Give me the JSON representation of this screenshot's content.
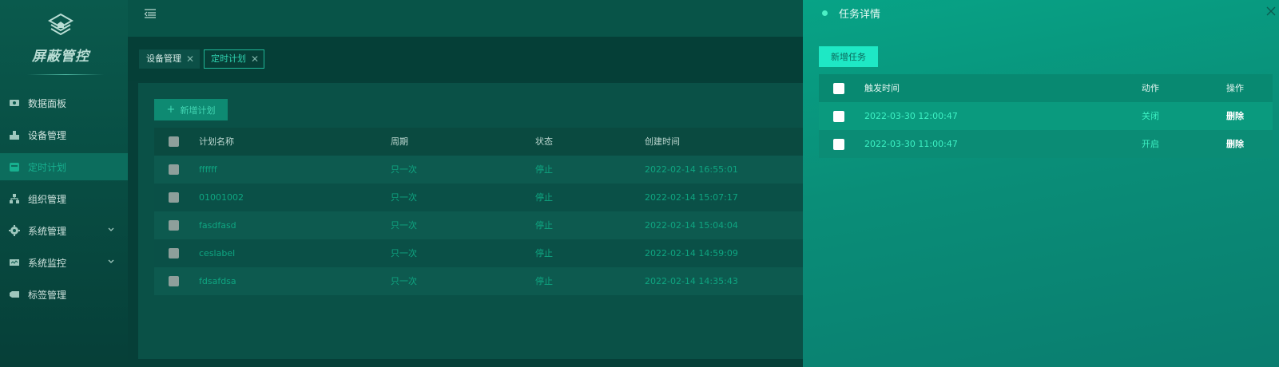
{
  "app": {
    "title": "屏蔽管控"
  },
  "sidebar": {
    "items": [
      {
        "label": "数据面板",
        "icon": "dashboard-icon"
      },
      {
        "label": "设备管理",
        "icon": "device-icon"
      },
      {
        "label": "定时计划",
        "icon": "schedule-icon",
        "active": true
      },
      {
        "label": "组织管理",
        "icon": "org-icon"
      },
      {
        "label": "系统管理",
        "icon": "gear-icon",
        "expandable": true
      },
      {
        "label": "系统监控",
        "icon": "monitor-icon",
        "expandable": true
      },
      {
        "label": "标签管理",
        "icon": "tag-icon"
      }
    ]
  },
  "tabs": [
    {
      "label": "设备管理"
    },
    {
      "label": "定时计划",
      "active": true
    }
  ],
  "main": {
    "add_button": "新增计划",
    "columns": [
      "计划名称",
      "周期",
      "状态",
      "创建时间"
    ],
    "rows": [
      {
        "name": "ffffff",
        "cycle": "只一次",
        "state": "停止",
        "created": "2022-02-14 16:55:01"
      },
      {
        "name": "01001002",
        "cycle": "只一次",
        "state": "停止",
        "created": "2022-02-14 15:07:17"
      },
      {
        "name": "fasdfasd",
        "cycle": "只一次",
        "state": "停止",
        "created": "2022-02-14 15:04:04"
      },
      {
        "name": "ceslabel",
        "cycle": "只一次",
        "state": "停止",
        "created": "2022-02-14 14:59:09"
      },
      {
        "name": "fdsafdsa",
        "cycle": "只一次",
        "state": "停止",
        "created": "2022-02-14 14:35:43"
      }
    ]
  },
  "drawer": {
    "title": "任务详情",
    "add_button": "新增任务",
    "columns": [
      "触发时间",
      "动作",
      "操作"
    ],
    "rows": [
      {
        "time": "2022-03-30 12:00:47",
        "action": "关闭",
        "op": "删除"
      },
      {
        "time": "2022-03-30 11:00:47",
        "action": "开启",
        "op": "删除"
      }
    ]
  },
  "colors": {
    "accent": "#1ee8c5",
    "active_text": "#17b08f",
    "drawer_bg": "#0a8e78"
  }
}
